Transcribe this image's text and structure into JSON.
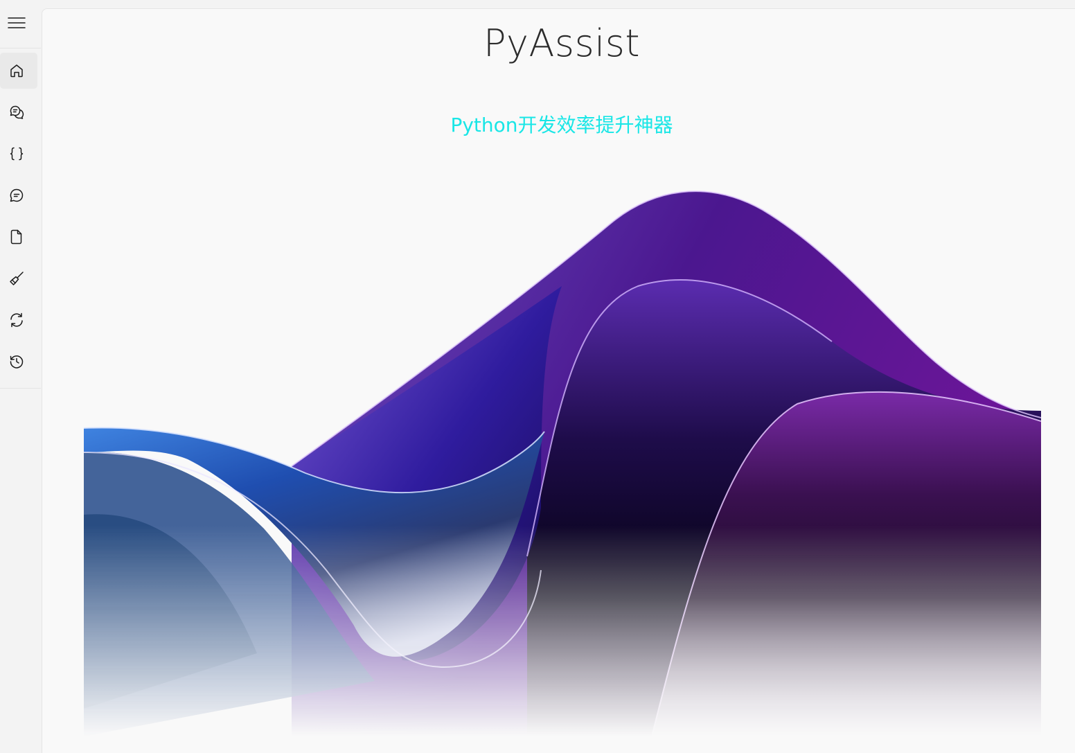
{
  "app": {
    "title": "PyAssist",
    "subtitle": "Python开发效率提升神器",
    "subtitle_color": "#19e6e6"
  },
  "sidebar": {
    "menu_icon": "hamburger-menu-icon",
    "items": [
      {
        "icon": "home-icon",
        "active": true
      },
      {
        "icon": "chat-bubbles-icon",
        "active": false
      },
      {
        "icon": "code-braces-icon",
        "active": false
      },
      {
        "icon": "message-icon",
        "active": false
      },
      {
        "icon": "document-icon",
        "active": false
      },
      {
        "icon": "brush-icon",
        "active": false
      },
      {
        "icon": "sync-icon",
        "active": false
      },
      {
        "icon": "history-icon",
        "active": false
      }
    ]
  },
  "banner": {
    "image": "abstract-wave-artwork",
    "colors": [
      "#2a5fd0",
      "#5a34b8",
      "#4a168c",
      "#0a0418"
    ]
  }
}
